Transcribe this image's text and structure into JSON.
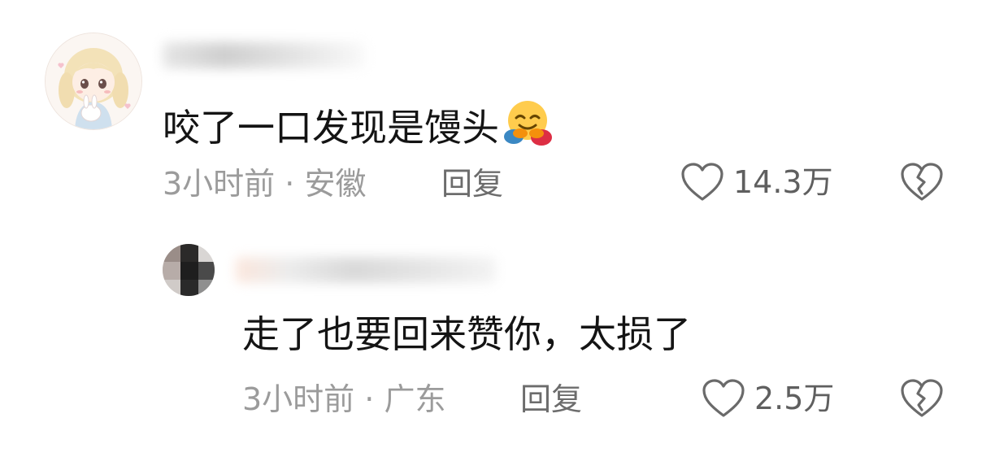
{
  "comments": [
    {
      "text": "咬了一口发现是馒头",
      "emoji": "hugging-face",
      "time": "3小时前",
      "separator": "·",
      "location": "安徽",
      "reply_label": "回复",
      "likes": "14.3万"
    },
    {
      "text": "走了也要回来赞你，太损了",
      "time": "3小时前",
      "separator": "·",
      "location": "广东",
      "reply_label": "回复",
      "likes": "2.5万"
    }
  ],
  "icons": {
    "like": "heart-outline-icon",
    "dislike": "broken-heart-icon"
  },
  "colors": {
    "meta_text": "#9b9b9b",
    "icon_stroke": "#6a6a6a",
    "main_text": "#141414"
  }
}
